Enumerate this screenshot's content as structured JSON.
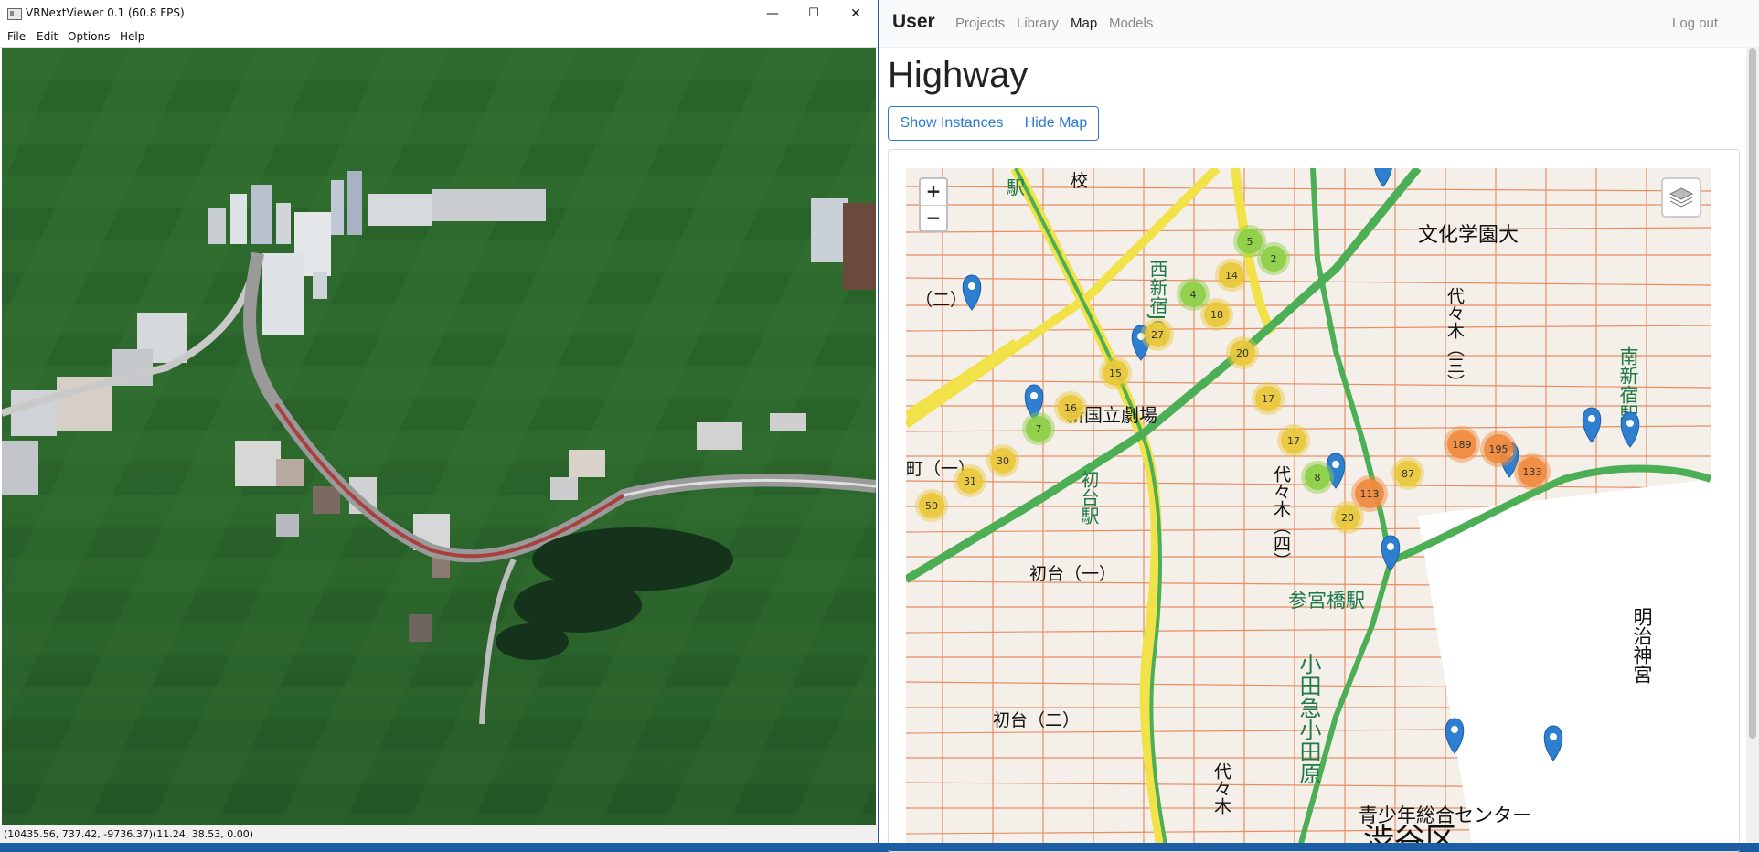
{
  "viewer": {
    "title": "VRNextViewer 0.1 (60.8 FPS)",
    "window_buttons": {
      "minimize": "—",
      "maximize": "☐",
      "close": "✕"
    },
    "menu": [
      "File",
      "Edit",
      "Options",
      "Help"
    ],
    "status": "(10435.56, 737.42, -9736.37)(11.24, 38.53, 0.00)"
  },
  "web": {
    "brand": "User",
    "nav": [
      "Projects",
      "Library",
      "Map",
      "Models"
    ],
    "active_nav": "Map",
    "logout": "Log out",
    "title": "Highway",
    "buttons": {
      "show_instances": "Show Instances",
      "hide_map": "Hide Map"
    },
    "map": {
      "zoom_in": "+",
      "zoom_out": "−",
      "labels": [
        "文化学園大",
        "西新宿JCT",
        "新国立劇場",
        "初台駅",
        "初台（一）",
        "初台（二）",
        "代々木（三）",
        "代々木（四）",
        "代々木",
        "参宮橋駅",
        "小田急小田原",
        "南新宿駅",
        "明治神宮",
        "青少年総合センター",
        "渋谷区",
        "町（一）",
        "（二）",
        "駅",
        "校"
      ],
      "clusters": [
        {
          "count": "5",
          "color": "green"
        },
        {
          "count": "2",
          "color": "green"
        },
        {
          "count": "14",
          "color": "yellow"
        },
        {
          "count": "4",
          "color": "green"
        },
        {
          "count": "18",
          "color": "yellow"
        },
        {
          "count": "27",
          "color": "yellow"
        },
        {
          "count": "20",
          "color": "yellow"
        },
        {
          "count": "15",
          "color": "yellow"
        },
        {
          "count": "16",
          "color": "yellow"
        },
        {
          "count": "17",
          "color": "yellow"
        },
        {
          "count": "7",
          "color": "green"
        },
        {
          "count": "17",
          "color": "yellow"
        },
        {
          "count": "30",
          "color": "yellow"
        },
        {
          "count": "31",
          "color": "yellow"
        },
        {
          "count": "50",
          "color": "yellow"
        },
        {
          "count": "8",
          "color": "green"
        },
        {
          "count": "87",
          "color": "yellow"
        },
        {
          "count": "189",
          "color": "orange"
        },
        {
          "count": "195",
          "color": "orange"
        },
        {
          "count": "113",
          "color": "orange"
        },
        {
          "count": "133",
          "color": "orange"
        },
        {
          "count": "20",
          "color": "yellow"
        }
      ],
      "cluster_colors": {
        "green": "#8ccf45",
        "yellow": "#e9c83a",
        "orange": "#ef8a3c"
      },
      "pin_color": "#2f7fd0"
    }
  }
}
